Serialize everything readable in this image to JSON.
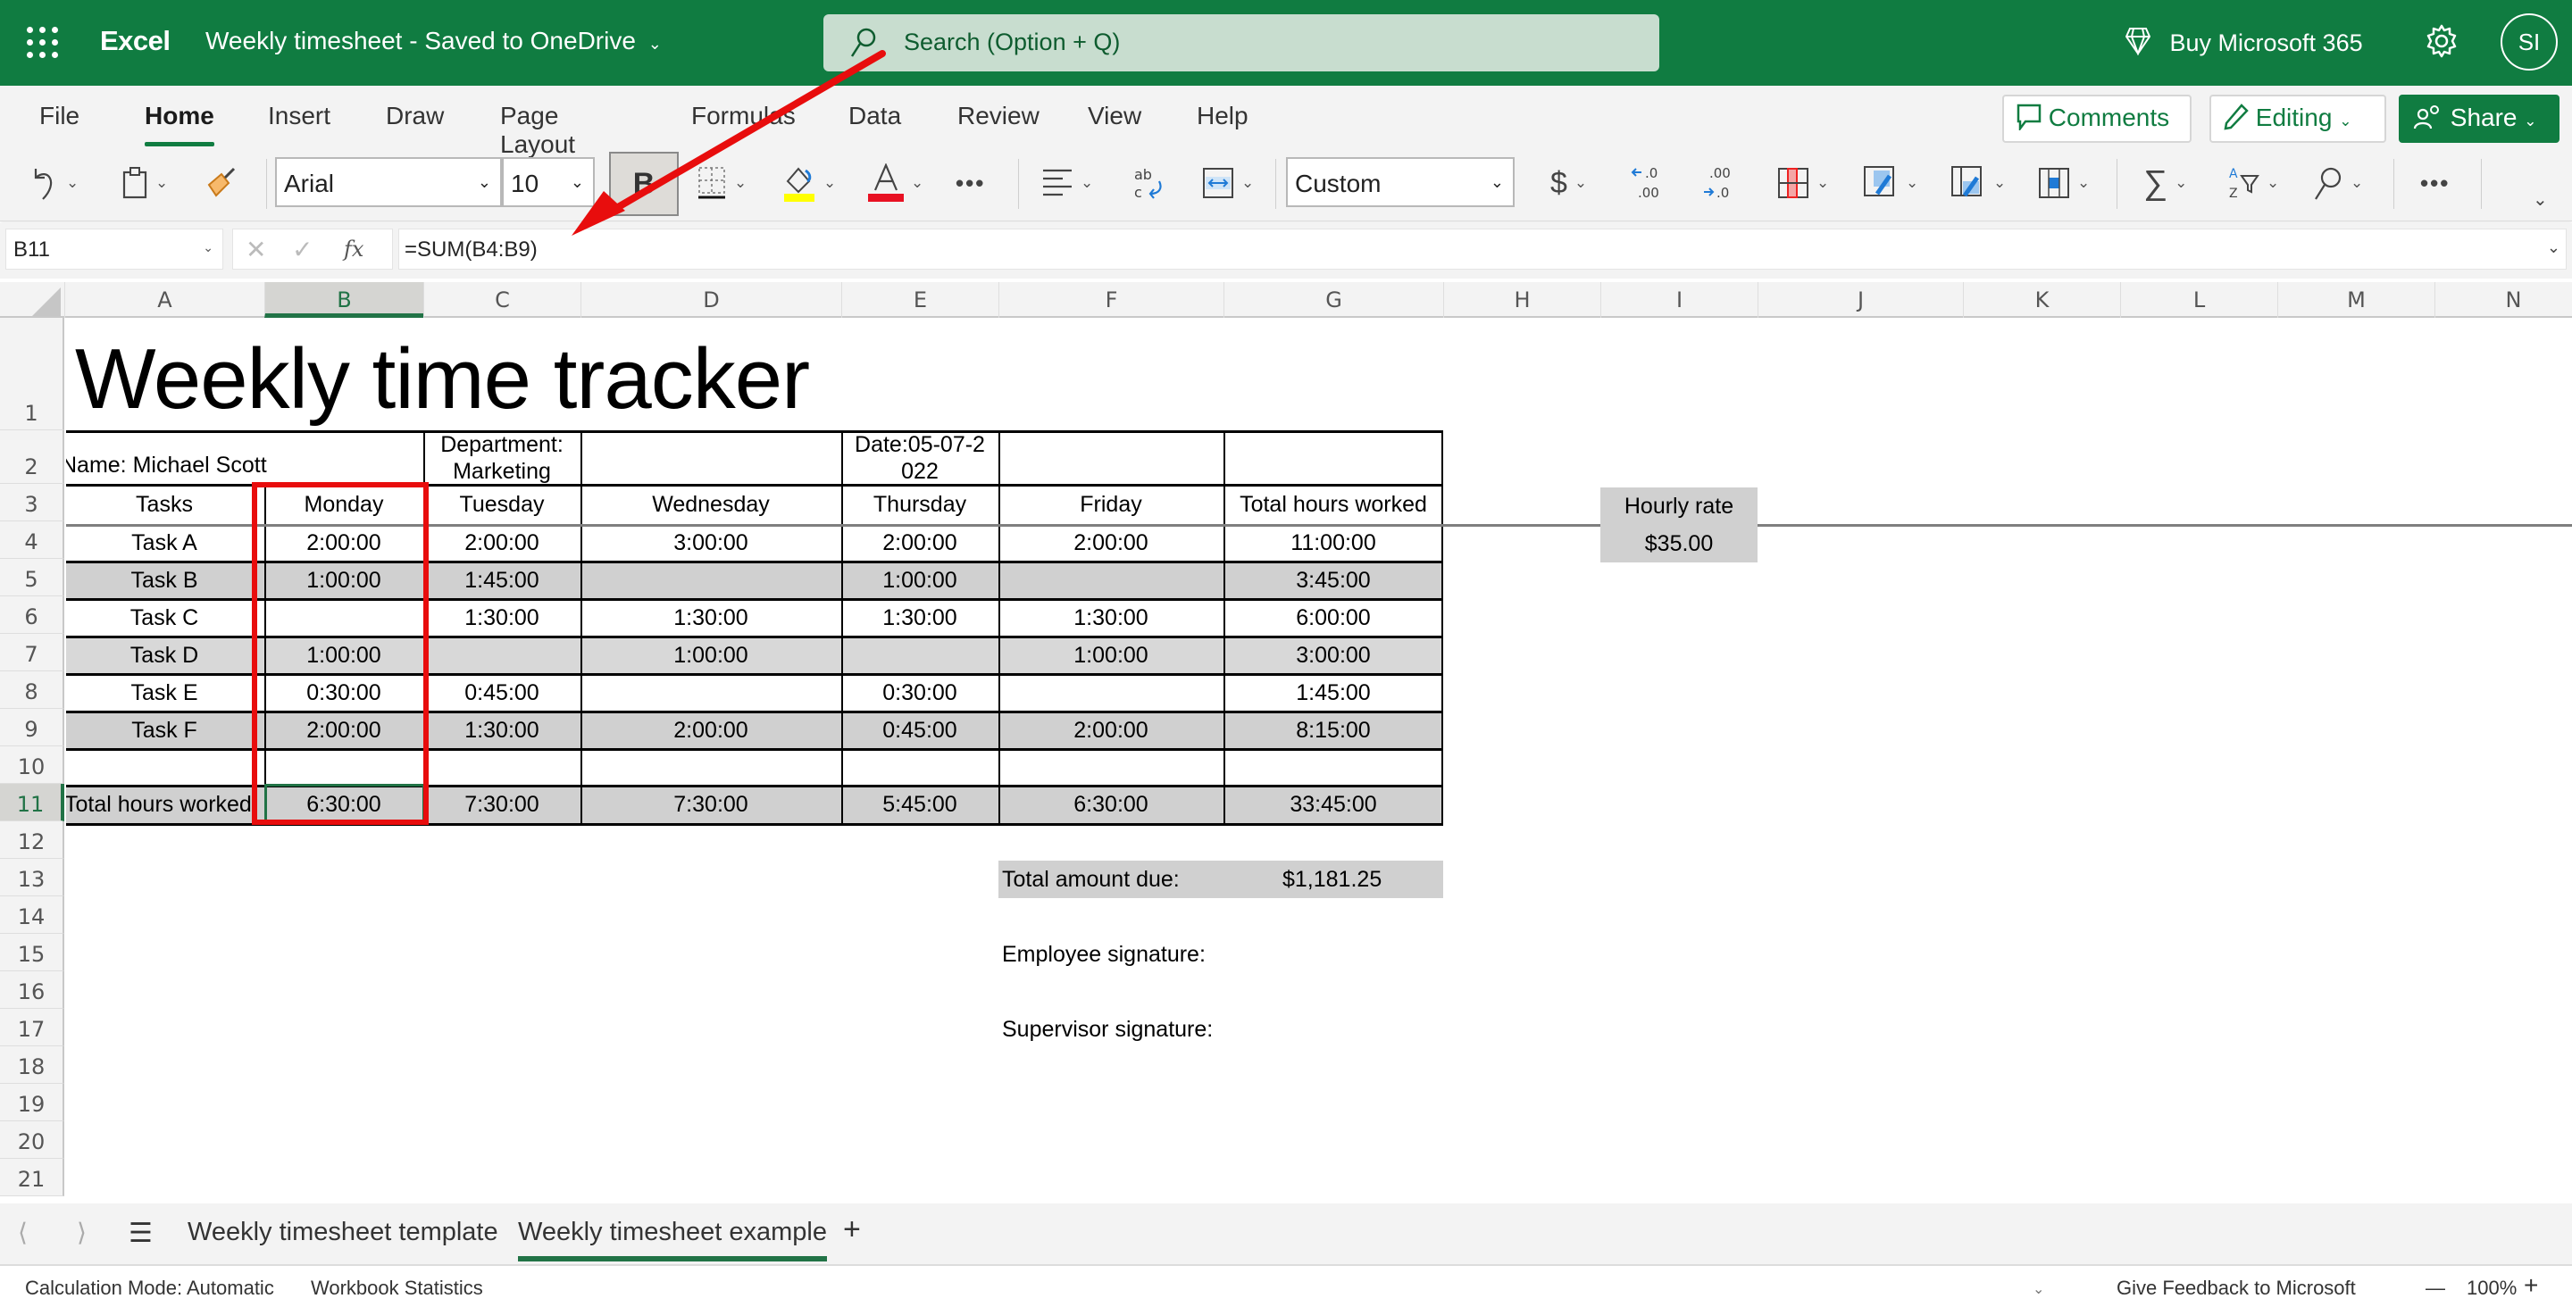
{
  "titlebar": {
    "app_name": "Excel",
    "doc_title": "Weekly timesheet",
    "save_status": "-  Saved to OneDrive",
    "search_placeholder": "Search (Option + Q)",
    "buy_label": "Buy Microsoft 365",
    "avatar_initials": "SI"
  },
  "ribbon": {
    "tabs": [
      {
        "label": "File"
      },
      {
        "label": "Home",
        "active": true
      },
      {
        "label": "Insert"
      },
      {
        "label": "Draw"
      },
      {
        "label": "Page Layout"
      },
      {
        "label": "Formulas"
      },
      {
        "label": "Data"
      },
      {
        "label": "Review"
      },
      {
        "label": "View"
      },
      {
        "label": "Help"
      }
    ],
    "comments_label": "Comments",
    "editing_label": "Editing",
    "share_label": "Share",
    "font_name": "Arial",
    "font_size": "10",
    "bold_label": "B",
    "number_format": "Custom",
    "currency_symbol": "$",
    "more_label": "•••",
    "colors": {
      "brand": "#107c41",
      "highlight": "#ffff00",
      "font_color": "#e81123"
    }
  },
  "formula_bar": {
    "name_box": "B11",
    "fx_label": "fx",
    "formula": "=SUM(B4:B9)"
  },
  "grid": {
    "columns": [
      "A",
      "B",
      "C",
      "D",
      "E",
      "F",
      "G",
      "H",
      "I",
      "J",
      "K",
      "L",
      "M",
      "N"
    ],
    "selected_column": "B",
    "rows": [
      "1",
      "2",
      "3",
      "4",
      "5",
      "6",
      "7",
      "8",
      "9",
      "10",
      "11",
      "12",
      "13",
      "14",
      "15",
      "16",
      "17",
      "18",
      "19",
      "20",
      "21"
    ],
    "selected_row": "11",
    "selected_cell": "B11"
  },
  "sheet": {
    "title": "Weekly time tracker",
    "name_label": "Name: Michael Scott",
    "department_label": "Department:",
    "department_value": "Marketing",
    "date_line1": "Date:05-07-2",
    "date_line2": "022",
    "headers": [
      "Tasks",
      "Monday",
      "Tuesday",
      "Wednesday",
      "Thursday",
      "Friday",
      "Total hours worked"
    ],
    "tasks": [
      {
        "task": "Task A",
        "mon": "2:00:00",
        "tue": "2:00:00",
        "wed": "3:00:00",
        "thu": "2:00:00",
        "fri": "2:00:00",
        "total": "11:00:00"
      },
      {
        "task": "Task B",
        "mon": "1:00:00",
        "tue": "1:45:00",
        "wed": "",
        "thu": "1:00:00",
        "fri": "",
        "total": "3:45:00"
      },
      {
        "task": "Task C",
        "mon": "",
        "tue": "1:30:00",
        "wed": "1:30:00",
        "thu": "1:30:00",
        "fri": "1:30:00",
        "total": "6:00:00"
      },
      {
        "task": "Task D",
        "mon": "1:00:00",
        "tue": "",
        "wed": "1:00:00",
        "thu": "",
        "fri": "1:00:00",
        "total": "3:00:00"
      },
      {
        "task": "Task E",
        "mon": "0:30:00",
        "tue": "0:45:00",
        "wed": "",
        "thu": "0:30:00",
        "fri": "",
        "total": "1:45:00"
      },
      {
        "task": "Task F",
        "mon": "2:00:00",
        "tue": "1:30:00",
        "wed": "2:00:00",
        "thu": "0:45:00",
        "fri": "2:00:00",
        "total": "8:15:00"
      }
    ],
    "totals": {
      "label": "Total hours worked",
      "mon": "6:30:00",
      "tue": "7:30:00",
      "wed": "7:30:00",
      "thu": "5:45:00",
      "fri": "6:30:00",
      "total": "33:45:00"
    },
    "hourly_rate_label": "Hourly rate",
    "hourly_rate_value": "$35.00",
    "amount_due_label": "Total amount due:",
    "amount_due_value": "$1,181.25",
    "employee_signature_label": "Employee signature:",
    "supervisor_signature_label": "Supervisor signature:"
  },
  "sheet_tabs": {
    "tabs": [
      {
        "label": "Weekly timesheet template"
      },
      {
        "label": "Weekly timesheet example",
        "active": true
      }
    ],
    "add_label": "+"
  },
  "status_bar": {
    "calc_mode": "Calculation Mode: Automatic",
    "workbook_stats": "Workbook Statistics",
    "feedback": "Give Feedback to Microsoft",
    "zoom_out": "—",
    "zoom_level": "100%",
    "zoom_in": "+"
  },
  "annotations": {
    "highlight_color": "#e80d0d",
    "highlighted_range": "B3:B11"
  }
}
